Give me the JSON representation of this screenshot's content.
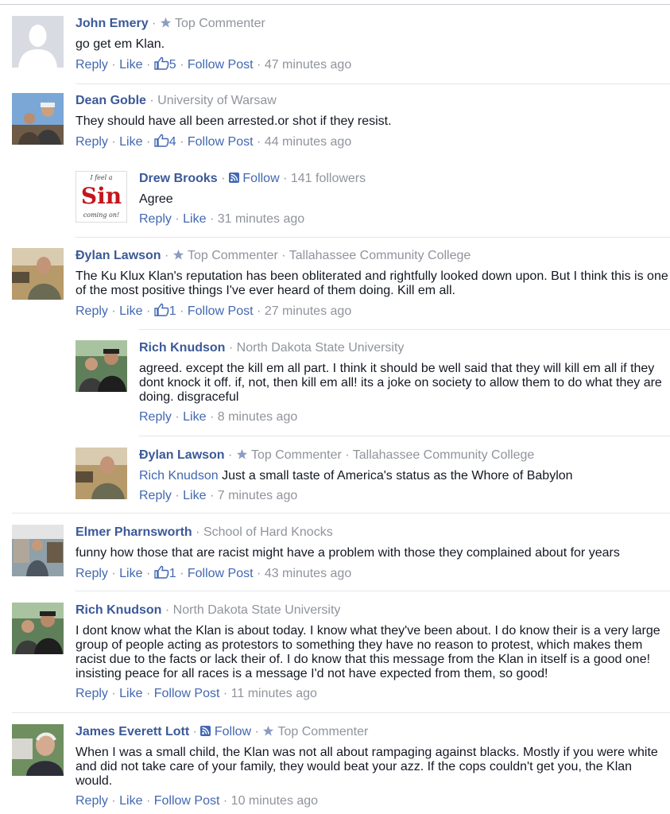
{
  "labels": {
    "reply": "Reply",
    "like": "Like",
    "follow_post": "Follow Post",
    "follow": "Follow",
    "top_commenter": "Top Commenter",
    "dot": "·"
  },
  "colors": {
    "link": "#4267b2",
    "name": "#3b5998",
    "meta": "#90949c",
    "divider": "#e5e6e9"
  },
  "comments": [
    {
      "name": "John Emery",
      "badge": "Top Commenter",
      "text": "go get em Klan.",
      "likes": "5",
      "time": "47 minutes ago"
    },
    {
      "name": "Dean Goble",
      "affiliation": "University of Warsaw",
      "text": "They should have all been arrested.or shot if they resist.",
      "likes": "4",
      "time": "44 minutes ago"
    },
    {
      "name": "Drew Brooks",
      "follow": "Follow",
      "followers": "141 followers",
      "text": "Agree",
      "time": "31 minutes ago",
      "avatar_text": [
        "I feel a",
        "Sin",
        "coming on!"
      ]
    },
    {
      "name": "Đylan Lawson",
      "badge": "Top Commenter",
      "affiliation": "Tallahassee Community College",
      "text_lines": [
        "The Ku Klux Klan's reputation has been obliterated and rightfully looked down upon. But I think this is one",
        "of the most positive things I've ever heard of them doing. Kill em all."
      ],
      "likes": "1",
      "time": "27 minutes ago"
    },
    {
      "name": "Rich Knudson",
      "affiliation": "North Dakota State University",
      "text_lines": [
        "agreed. except the kill em all part. I think it should be well said that they will kill em all if they",
        "dont knock it off. if, not, then kill em all! its a joke on society to allow them to do what they are",
        "doing. disgraceful"
      ],
      "time": "8 minutes ago"
    },
    {
      "name": "Đylan Lawson",
      "badge": "Top Commenter",
      "affiliation": "Tallahassee Community College",
      "mention": "Rich Knudson",
      "text": "Just a small taste of America's status as the Whore of Babylon",
      "time": "7 minutes ago"
    },
    {
      "name": "Elmer Pharnsworth",
      "affiliation": "School of Hard Knocks",
      "text": "funny how those that are racist might have a problem with those they complained about for years",
      "likes": "1",
      "time": "43 minutes ago"
    },
    {
      "name": "Rich Knudson",
      "affiliation": "North Dakota State University",
      "text_lines": [
        "I dont know what the Klan is about today. I know what they've been about. I do know their is a very large",
        "group of people acting as protestors to something they have no reason to protest, which makes them",
        "racist due to the facts or lack their of. I do know that this message from the Klan in itself is a good one!",
        "insisting peace for all races is a message I'd not have expected from them, so good!"
      ],
      "time": "11 minutes ago"
    },
    {
      "name": "James Everett Lott",
      "follow": "Follow",
      "badge": "Top Commenter",
      "text_lines": [
        "When I was a small child, the Klan was not all about rampaging against blacks. Mostly if you were white",
        "and did not take care of your family, they would beat your azz. If the cops couldn't get you, the Klan",
        "would."
      ],
      "time": "10 minutes ago"
    }
  ]
}
